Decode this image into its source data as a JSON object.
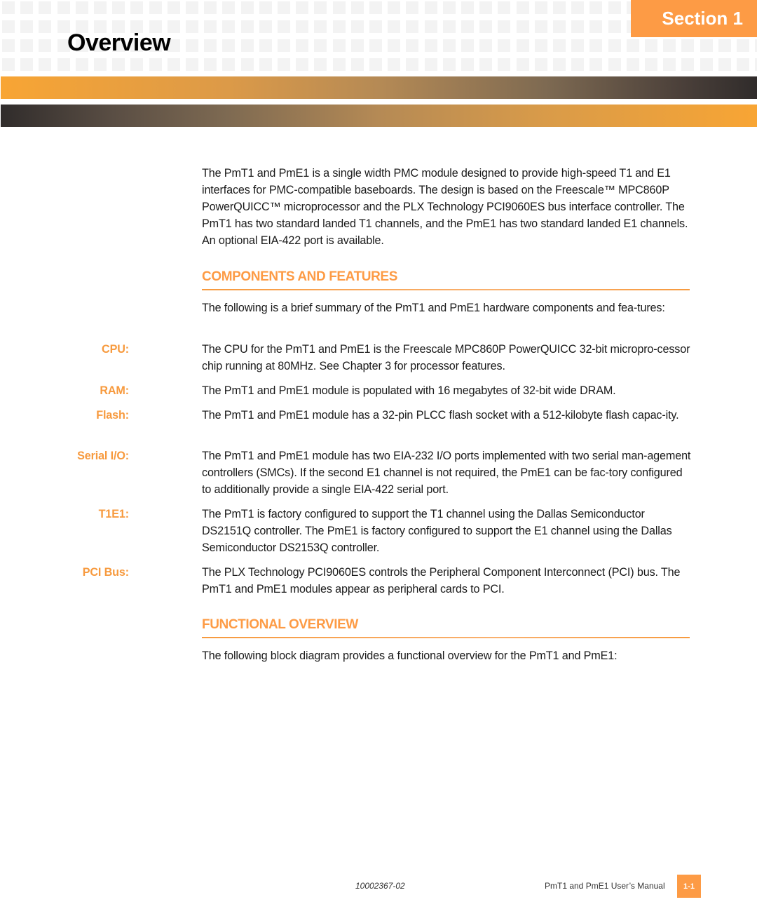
{
  "header": {
    "section_label": "Section 1",
    "page_title": "Overview"
  },
  "intro": "The PmT1 and PmE1 is a single width PMC module designed to provide high-speed T1 and E1 interfaces for PMC-compatible baseboards. The design is based on the Freescale™ MPC860P PowerQUICC™ microprocessor and the PLX Technology PCI9060ES bus interface controller. The PmT1 has two standard landed T1 channels, and the PmE1 has two standard landed E1 channels. An optional EIA-422 port is available.",
  "components": {
    "heading": "COMPONENTS AND FEATURES",
    "intro": "The following is a brief summary of the PmT1 and PmE1 hardware components and fea-tures:",
    "items": [
      {
        "label": "CPU:",
        "text": "The CPU for the PmT1 and PmE1 is the Freescale MPC860P PowerQUICC 32-bit micropro-cessor chip running at 80MHz. See Chapter 3 for processor features."
      },
      {
        "label": "RAM:",
        "text": "The PmT1 and PmE1 module is populated with 16 megabytes of 32-bit wide DRAM."
      },
      {
        "label": "Flash:",
        "text": "The PmT1 and PmE1 module has a 32-pin PLCC flash socket with a 512-kilobyte flash capac-ity."
      },
      {
        "label": "Serial I/O:",
        "text": "The PmT1 and PmE1 module has two EIA-232 I/O ports implemented with two serial man-agement controllers (SMCs). If the second E1 channel is not required, the PmE1 can be fac-tory configured to additionally provide a single EIA-422 serial port."
      },
      {
        "label": "T1E1:",
        "text": "The PmT1 is factory configured to support the T1 channel using the Dallas Semiconductor DS2151Q controller. The PmE1 is factory configured to support the E1 channel using the Dallas Semiconductor DS2153Q controller."
      },
      {
        "label": "PCI Bus:",
        "text": "The PLX Technology PCI9060ES controls the Peripheral Component Interconnect (PCI) bus. The PmT1 and PmE1 modules appear as peripheral cards to PCI."
      }
    ]
  },
  "functional": {
    "heading": "FUNCTIONAL OVERVIEW",
    "intro": "The following block diagram provides a functional overview for the PmT1 and PmE1:"
  },
  "footer": {
    "doc_number": "10002367-02",
    "manual_title": "PmT1 and PmE1 User’s Manual",
    "page_number": "1-1"
  },
  "colors": {
    "accent": "#fd9b45",
    "label": "#f79a3e",
    "grid_square": "#f3f3f3"
  }
}
